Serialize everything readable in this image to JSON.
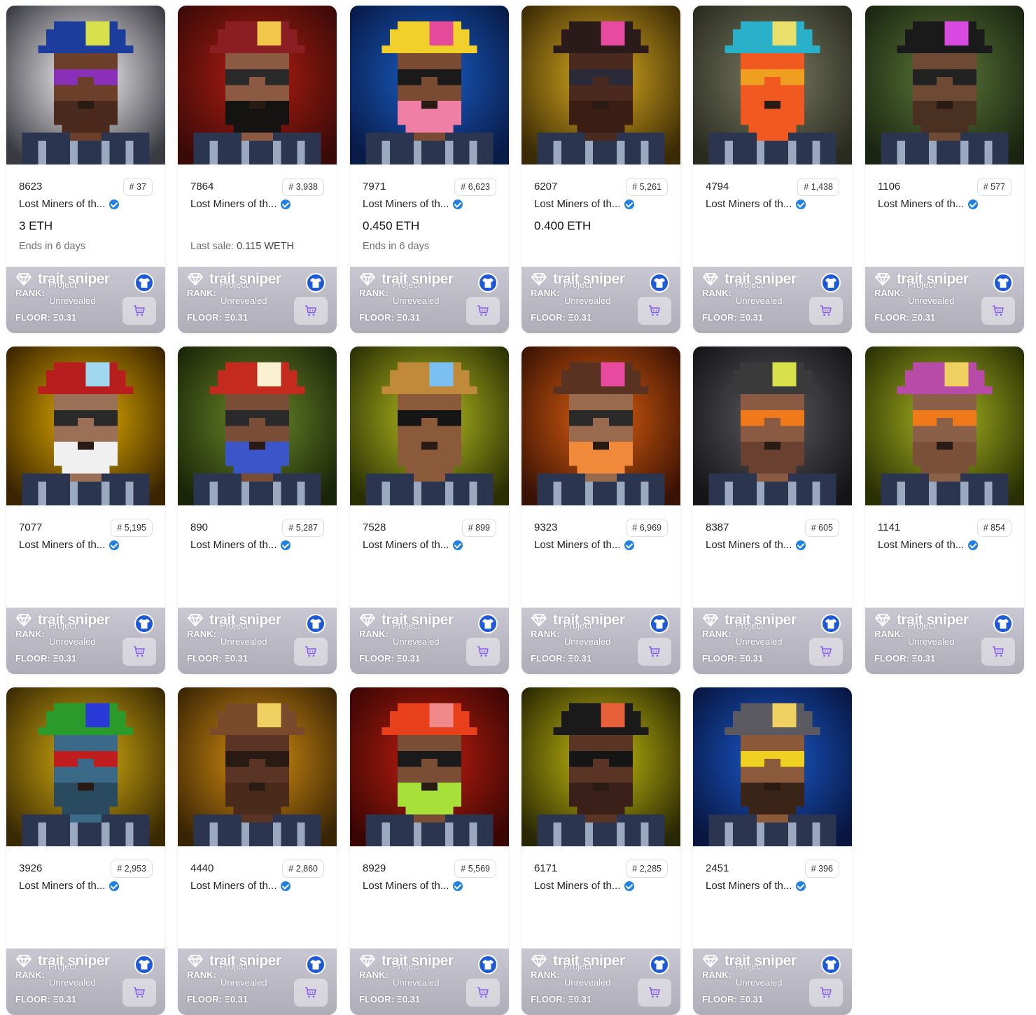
{
  "collection_name": "Lost Miners of th...",
  "trait_sniper": {
    "logo": "trait sniper",
    "project_label": "Project",
    "rank_label": "RANK:",
    "rank_value": "Unrevealed",
    "floor_label": "FLOOR:",
    "floor_value": "Ξ0.31"
  },
  "icons": {
    "verified": "verified-badge-icon",
    "diamond": "diamond-icon",
    "shirt": "tshirt-icon",
    "cart": "cart-icon"
  },
  "colors": {
    "verified": "#2081e2",
    "shirt_button": "#1e5ad6",
    "cart_icon": "#8a5cf6",
    "ts_bar": "#bdbcc7"
  },
  "cards": [
    {
      "id": "8623",
      "rank": "# 37",
      "price": "3 ETH",
      "sub": "Ends in 6 days",
      "sub_strong": "",
      "bg": [
        "#ffffff",
        "#3a3a42"
      ],
      "skin": "#6b3f2a",
      "hat": "#1d3d9c",
      "gem": "#d8e04a",
      "beard": "#4a2a1c",
      "glass": "#8a2fb8"
    },
    {
      "id": "7864",
      "rank": "# 3,938",
      "price": "",
      "sub": "Last sale: ",
      "sub_strong": "0.115 WETH",
      "bg": [
        "#b51d12",
        "#3a0a08"
      ],
      "skin": "#8c5a43",
      "hat": "#8a1e22",
      "gem": "#f2c84a",
      "beard": "#151212",
      "glass": "#2a2a2a"
    },
    {
      "id": "7971",
      "rank": "# 6,623",
      "price": "0.450 ETH",
      "sub": "Ends in 6 days",
      "sub_strong": "",
      "bg": [
        "#1a5fc9",
        "#081a46"
      ],
      "skin": "#7a4a33",
      "hat": "#f1d02c",
      "gem": "#e64a9a",
      "beard": "#f07fa6",
      "glass": "#1a1a1a"
    },
    {
      "id": "6207",
      "rank": "# 5,261",
      "price": "0.400 ETH",
      "sub": "",
      "sub_strong": "",
      "bg": [
        "#e0b020",
        "#3a2a06"
      ],
      "skin": "#4a2a1e",
      "hat": "#2a1a1a",
      "gem": "#e84aa0",
      "beard": "#3a1e14",
      "glass": "#2a2a38"
    },
    {
      "id": "4794",
      "rank": "# 1,438",
      "price": "",
      "sub": "",
      "sub_strong": "",
      "bg": [
        "#7b7e62",
        "#2a2b20"
      ],
      "skin": "#f05a20",
      "hat": "#2ab0c8",
      "gem": "#e8e06a",
      "beard": "#f05a20",
      "glass": "#f0a020"
    },
    {
      "id": "1106",
      "rank": "# 577",
      "price": "",
      "sub": "",
      "sub_strong": "",
      "bg": [
        "#5c7a3a",
        "#1a2410"
      ],
      "skin": "#6e4a35",
      "hat": "#1a1a1a",
      "gem": "#d84ae0",
      "beard": "#4a3020",
      "glass": "#222"
    },
    {
      "id": "7077",
      "rank": "# 5,195",
      "price": "",
      "sub": "",
      "sub_strong": "",
      "bg": [
        "#e6b000",
        "#3a2400"
      ],
      "skin": "#9a7056",
      "hat": "#b81e1e",
      "gem": "#a0d8f0",
      "beard": "#f0f0f0",
      "glass": "#2a2a2a"
    },
    {
      "id": "890",
      "rank": "# 5,287",
      "price": "",
      "sub": "",
      "sub_strong": "",
      "bg": [
        "#6b8b2a",
        "#1a2408"
      ],
      "skin": "#7a4e36",
      "hat": "#c42a1e",
      "gem": "#f8f0d0",
      "beard": "#3a56c8",
      "glass": "#2a2a2a"
    },
    {
      "id": "7528",
      "rank": "# 899",
      "price": "",
      "sub": "",
      "sub_strong": "",
      "bg": [
        "#b8c020",
        "#2a3004"
      ],
      "skin": "#8a5a3a",
      "hat": "#c08a3a",
      "gem": "#7ac0f0",
      "beard": "#8a5a3a",
      "glass": "#151515"
    },
    {
      "id": "9323",
      "rank": "# 6,969",
      "price": "",
      "sub": "",
      "sub_strong": "",
      "bg": [
        "#e06010",
        "#3a1204"
      ],
      "skin": "#9a6a4e",
      "hat": "#5a3222",
      "gem": "#e84aa0",
      "beard": "#f08a3a",
      "glass": "#2a2a2a"
    },
    {
      "id": "8387",
      "rank": "# 605",
      "price": "",
      "sub": "",
      "sub_strong": "",
      "bg": [
        "#5a5a60",
        "#151518"
      ],
      "skin": "#8a5a42",
      "hat": "#3a3a3a",
      "gem": "#d8e04a",
      "beard": "#6a4030",
      "glass": "#f07a1a"
    },
    {
      "id": "1141",
      "rank": "# 854",
      "price": "",
      "sub": "",
      "sub_strong": "",
      "bg": [
        "#a8b820",
        "#2a3004"
      ],
      "skin": "#8a6048",
      "hat": "#b84aa8",
      "gem": "#f0d060",
      "beard": "#7a5038",
      "glass": "#f07a1a"
    },
    {
      "id": "3926",
      "rank": "# 2,953",
      "price": "",
      "sub": "",
      "sub_strong": "",
      "bg": [
        "#d8b010",
        "#3a2a04"
      ],
      "skin": "#3a6a88",
      "hat": "#2a9a2a",
      "gem": "#2a3ad8",
      "beard": "#2a4a60",
      "glass": "#c01e1e"
    },
    {
      "id": "4440",
      "rank": "# 2,860",
      "price": "",
      "sub": "",
      "sub_strong": "",
      "bg": [
        "#d89010",
        "#3a2406"
      ],
      "skin": "#5a3424",
      "hat": "#7a4a2a",
      "gem": "#f0d060",
      "beard": "#4a2a1a",
      "glass": "#2a1a14"
    },
    {
      "id": "8929",
      "rank": "# 5,569",
      "price": "",
      "sub": "",
      "sub_strong": "",
      "bg": [
        "#c01e10",
        "#3a0604"
      ],
      "skin": "#7a4e34",
      "hat": "#e8401a",
      "gem": "#f08a8a",
      "beard": "#a8e03a",
      "glass": "#1a1a1a"
    },
    {
      "id": "6171",
      "rank": "# 2,285",
      "price": "",
      "sub": "",
      "sub_strong": "",
      "bg": [
        "#c8c010",
        "#2a2804"
      ],
      "skin": "#5a3424",
      "hat": "#1a1a1a",
      "gem": "#e8603a",
      "beard": "#3a2018",
      "glass": "#151515"
    },
    {
      "id": "2451",
      "rank": "# 396",
      "price": "",
      "sub": "",
      "sub_strong": "",
      "bg": [
        "#1a5ad0",
        "#081640"
      ],
      "skin": "#8a5a3a",
      "hat": "#5a5a60",
      "gem": "#f0d060",
      "beard": "#3a2418",
      "glass": "#f0d020"
    }
  ]
}
